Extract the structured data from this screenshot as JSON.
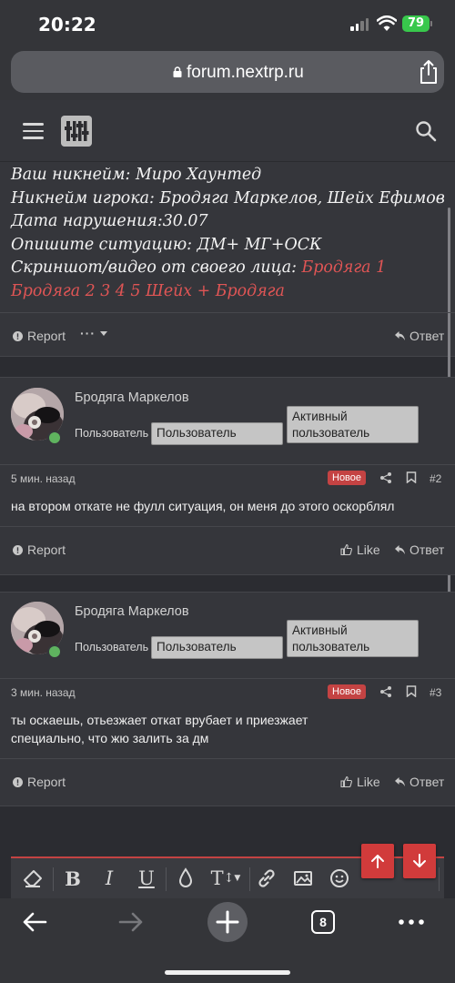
{
  "status_bar": {
    "time": "20:22",
    "battery": "79"
  },
  "browser": {
    "url": "forum.nextrp.ru",
    "tabs_count": "8"
  },
  "post0": {
    "lines": [
      "Ваш никнейм: Миро Хаунтед",
      "Никнейм игрока: Бродяга Маркелов, Шейх Ефимов",
      "Дата нарушения:30.07",
      "Опишите ситуацию: ДМ+ МГ+ОСК"
    ],
    "screenshot_label": "Скриншот/видео от своего лица: ",
    "screenshot_links": "Бродяга 1 Бродяга 2 3 4 5 Шейх + Бродяга",
    "report_label": "Report",
    "more_label": "···",
    "reply_label": "Ответ"
  },
  "posts": [
    {
      "author": "Бродяга Маркелов",
      "role_label": "Пользователь",
      "badge_user": "Пользователь",
      "badge_active_1": "Активный",
      "badge_active_2": "пользователь",
      "time": "5 мин. назад",
      "new_badge": "Новое",
      "number": "#2",
      "text": "на втором откате не фулл ситуация, он меня до этого оскорблял",
      "report_label": "Report",
      "like_label": "Like",
      "reply_label": "Ответ"
    },
    {
      "author": "Бродяга Маркелов",
      "role_label": "Пользователь",
      "badge_user": "Пользователь",
      "badge_active_1": "Активный",
      "badge_active_2": "пользователь",
      "time": "3 мин. назад",
      "new_badge": "Новое",
      "number": "#3",
      "text": "ты оскаешь, отьезжает откат врубает и приезжает специально, что жю залить за дм",
      "report_label": "Report",
      "like_label": "Like",
      "reply_label": "Ответ"
    }
  ],
  "editor": {
    "bold": "B",
    "italic": "I",
    "underline": "U",
    "text_size": "T"
  },
  "colors": {
    "accent_red": "#c44343",
    "background": "#2b2c31",
    "panel": "#35363b"
  }
}
